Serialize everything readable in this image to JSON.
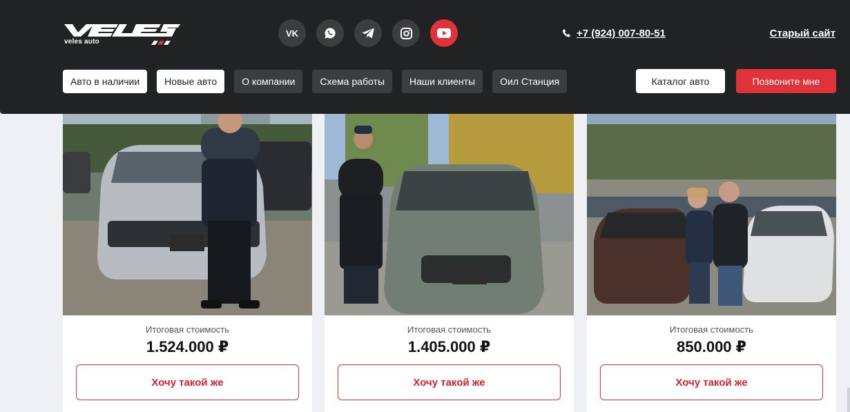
{
  "header": {
    "logo_sub": "veles auto",
    "phone": "+7 (924) 007-80-51",
    "old_site": "Старый сайт",
    "socials": [
      {
        "name": "vk-icon"
      },
      {
        "name": "whatsapp-icon"
      },
      {
        "name": "telegram-icon"
      },
      {
        "name": "instagram-icon"
      },
      {
        "name": "youtube-icon"
      }
    ],
    "accent_color": "#e0323a",
    "background_color": "#202223"
  },
  "nav": {
    "items": [
      {
        "label": "Авто в наличии"
      },
      {
        "label": "Новые авто"
      },
      {
        "label": "О компании"
      },
      {
        "label": "Схема работы"
      },
      {
        "label": "Наши клиенты"
      },
      {
        "label": "Оил Станция"
      }
    ],
    "catalog": "Каталог авто",
    "call_me": "Позвоните мне"
  },
  "cards": [
    {
      "price_label": "Итоговая стоимость",
      "price": "1.524.000 ₽",
      "cta": "Хочу такой же"
    },
    {
      "price_label": "Итоговая стоимость",
      "price": "1.405.000 ₽",
      "cta": "Хочу такой же"
    },
    {
      "price_label": "Итоговая стоимость",
      "price": "850.000 ₽",
      "cta": "Хочу такой же"
    }
  ]
}
